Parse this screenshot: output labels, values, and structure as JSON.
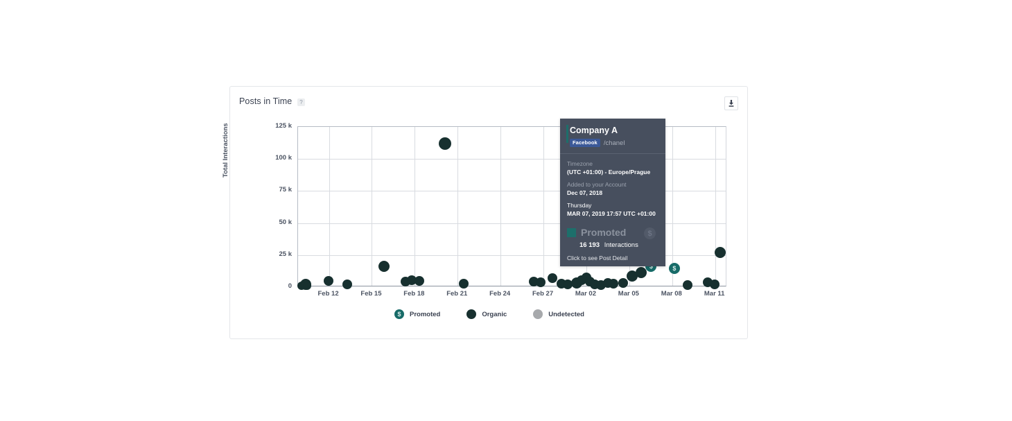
{
  "card": {
    "title": "Posts in Time",
    "help_badge": "?",
    "download_icon": "download-icon"
  },
  "chart_data": {
    "type": "scatter",
    "title": "Posts in Time",
    "xlabel": "",
    "ylabel": "Total Interactions",
    "grid": true,
    "legend_position": "bottom",
    "ylim": [
      0,
      125000
    ],
    "ytick_labels": [
      "125 k",
      "100 k",
      "75 k",
      "50 k",
      "25 k",
      "0"
    ],
    "ytick_values": [
      125000,
      100000,
      75000,
      50000,
      25000,
      0
    ],
    "xtick_labels": [
      "Feb 12",
      "Feb 15",
      "Feb 18",
      "Feb 21",
      "Feb 24",
      "Feb 27",
      "Mar 02",
      "Mar 05",
      "Mar 08",
      "Mar 11"
    ],
    "series": [
      {
        "name": "Promoted",
        "color": "#176b68",
        "marker": "dollar-circle"
      },
      {
        "name": "Organic",
        "color": "#17302f",
        "marker": "circle"
      },
      {
        "name": "Undetected",
        "color": "#a7a9ac",
        "marker": "circle"
      }
    ],
    "points": [
      {
        "x": 0.6,
        "y": 1200,
        "type": "organic",
        "r": 6
      },
      {
        "x": 1.2,
        "y": 2200,
        "type": "organic",
        "r": 8
      },
      {
        "x": 1.5,
        "y": 900,
        "type": "organic",
        "r": 6
      },
      {
        "x": 5.0,
        "y": 5000,
        "type": "organic",
        "r": 7
      },
      {
        "x": 8.0,
        "y": 2100,
        "type": "organic",
        "r": 7
      },
      {
        "x": 14.0,
        "y": 16500,
        "type": "organic",
        "r": 8
      },
      {
        "x": 17.5,
        "y": 4200,
        "type": "organic",
        "r": 7
      },
      {
        "x": 18.6,
        "y": 5200,
        "type": "organic",
        "r": 7
      },
      {
        "x": 19.8,
        "y": 4600,
        "type": "organic",
        "r": 7
      },
      {
        "x": 24.0,
        "y": 112000,
        "type": "organic",
        "r": 9
      },
      {
        "x": 27.0,
        "y": 2600,
        "type": "organic",
        "r": 7
      },
      {
        "x": 38.5,
        "y": 4500,
        "type": "organic",
        "r": 7
      },
      {
        "x": 39.6,
        "y": 4000,
        "type": "organic",
        "r": 7
      },
      {
        "x": 41.5,
        "y": 7100,
        "type": "organic",
        "r": 7
      },
      {
        "x": 43.0,
        "y": 2800,
        "type": "organic",
        "r": 7
      },
      {
        "x": 44.0,
        "y": 2100,
        "type": "organic",
        "r": 7
      },
      {
        "x": 45.5,
        "y": 3000,
        "type": "organic",
        "r": 8
      },
      {
        "x": 46.3,
        "y": 5300,
        "type": "organic",
        "r": 7
      },
      {
        "x": 47.0,
        "y": 7600,
        "type": "organic",
        "r": 7
      },
      {
        "x": 47.6,
        "y": 4300,
        "type": "organic",
        "r": 7
      },
      {
        "x": 48.4,
        "y": 2300,
        "type": "organic",
        "r": 7
      },
      {
        "x": 49.4,
        "y": 1500,
        "type": "organic",
        "r": 7
      },
      {
        "x": 50.6,
        "y": 3100,
        "type": "organic",
        "r": 7
      },
      {
        "x": 51.5,
        "y": 2600,
        "type": "organic",
        "r": 7
      },
      {
        "x": 53.0,
        "y": 3400,
        "type": "organic",
        "r": 7
      },
      {
        "x": 54.5,
        "y": 8900,
        "type": "organic",
        "r": 8
      },
      {
        "x": 56.0,
        "y": 11500,
        "type": "organic",
        "r": 8
      },
      {
        "x": 57.6,
        "y": 16193,
        "type": "promoted",
        "r": 8
      },
      {
        "x": 61.4,
        "y": 14500,
        "type": "promoted",
        "r": 8
      },
      {
        "x": 63.5,
        "y": 1600,
        "type": "organic",
        "r": 7
      },
      {
        "x": 66.8,
        "y": 4000,
        "type": "organic",
        "r": 7
      },
      {
        "x": 68.0,
        "y": 2000,
        "type": "organic",
        "r": 7
      },
      {
        "x": 68.9,
        "y": 26800,
        "type": "organic",
        "r": 8
      }
    ]
  },
  "legend": [
    {
      "label": "Promoted",
      "icon": "dollar-circle-icon",
      "symbol": "$",
      "color": "#176b68"
    },
    {
      "label": "Organic",
      "icon": "circle-icon",
      "symbol": "",
      "color": "#17302f"
    },
    {
      "label": "Undetected",
      "icon": "circle-icon",
      "symbol": "",
      "color": "#a7a9ac"
    }
  ],
  "tooltip": {
    "profile_name": "Company A",
    "network": "Facebook",
    "handle": "/chanel",
    "timezone_label": "Timezone",
    "timezone_value": "(UTC +01:00) - Europe/Prague",
    "added_label": "Added to your Account",
    "added_value": "Dec 07, 2018",
    "weekday": "Thursday",
    "datetime": "MAR 07, 2019 17:57 UTC +01:00",
    "metric_title": "Promoted",
    "metric_value": "16 193",
    "metric_unit": "Interactions",
    "watermark_symbol": "$",
    "footer": "Click to see Post Detail"
  }
}
